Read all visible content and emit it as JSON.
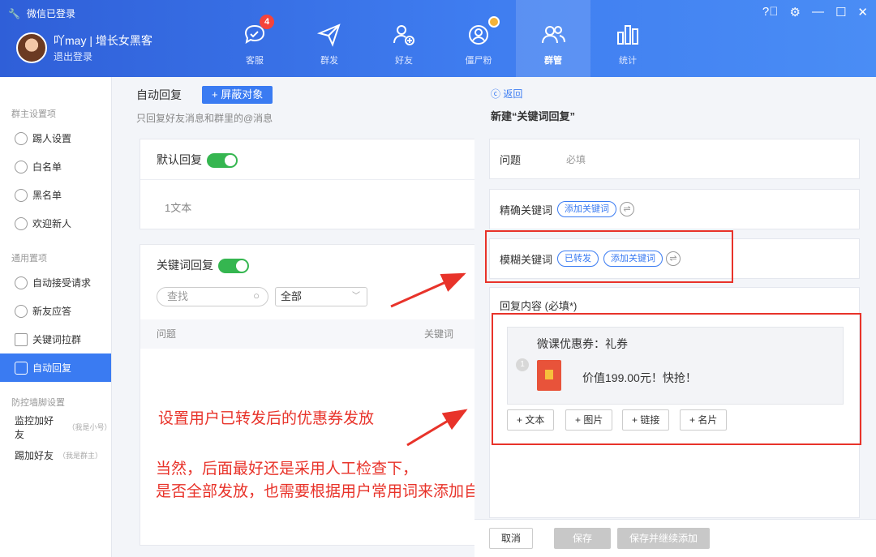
{
  "titlebar": {
    "brand": "微信已登录",
    "user_name": "吖may | 增长女黑客",
    "logout": "退出登录",
    "window_controls": [
      "help-icon",
      "settings-icon",
      "minimize-icon",
      "maximize-icon",
      "close-icon"
    ]
  },
  "nav": {
    "items": [
      {
        "label": "客服",
        "icon": "chat-icon",
        "badge": "4"
      },
      {
        "label": "群发",
        "icon": "send-icon"
      },
      {
        "label": "好友",
        "icon": "add-friend-icon"
      },
      {
        "label": "僵尸粉",
        "icon": "zombie-icon"
      },
      {
        "label": "群管",
        "icon": "group-manage-icon"
      },
      {
        "label": "统计",
        "icon": "bar-chart-icon"
      }
    ],
    "active": "群管"
  },
  "sidebar": {
    "sections": [
      {
        "title": "群主设置项",
        "items": [
          "踢人设置",
          "白名单",
          "黑名单",
          "欢迎新人"
        ]
      },
      {
        "title": "通用置项",
        "items": [
          "自动接受请求",
          "新友应答",
          "关键词拉群",
          "自动回复"
        ]
      },
      {
        "title": "防控墙脚设置",
        "items": [
          "监控加好友",
          "踢加好友"
        ]
      }
    ],
    "extra": {
      "monitor_note": "（我是小号）",
      "kick_note": "（我是群主）"
    },
    "active_label": "自动回复"
  },
  "main": {
    "title": "自动回复",
    "shield_button": "+ 屏蔽对象",
    "subtitle": "只回复好友消息和群里的@消息",
    "default_reply": {
      "label": "默认回复",
      "content": "1文本",
      "enabled": true
    },
    "keyword_reply": {
      "label": "关键词回复",
      "enabled": true,
      "search_placeholder": "查找",
      "filter": "全部",
      "col_question": "问题",
      "col_keyword": "关键词"
    }
  },
  "annotations": {
    "line1": "设置用户已转发后的优惠券发放",
    "line2": "当然，后面最好还是采用人工检查下，",
    "line3": "是否全部发放，也需要根据用户常用词来添加自动回复关键词",
    "color": "#e8332a"
  },
  "panel": {
    "back": "返回",
    "title": "新建“关键词回复”",
    "question_label": "问题",
    "question_placeholder": "必填",
    "exact_label": "精确关键词",
    "add_keyword": "添加关键词",
    "fuzzy_label": "模糊关键词",
    "fuzzy_tag": "已转发",
    "reply_label": "回复内容 (必填*)",
    "coupon_title": "微课优惠券：礼券",
    "coupon_desc": "价值199.00元！快抢！",
    "coupon_index": "1",
    "add_buttons": [
      "+ 文本",
      "+ 图片",
      "+ 链接",
      "+ 名片"
    ],
    "footer": {
      "cancel": "取消",
      "save": "保存",
      "save_continue": "保存并继续添加"
    }
  },
  "colors": {
    "accent": "#3a7bf2",
    "toggle_on": "#35b650",
    "annotation": "#e8332a"
  }
}
